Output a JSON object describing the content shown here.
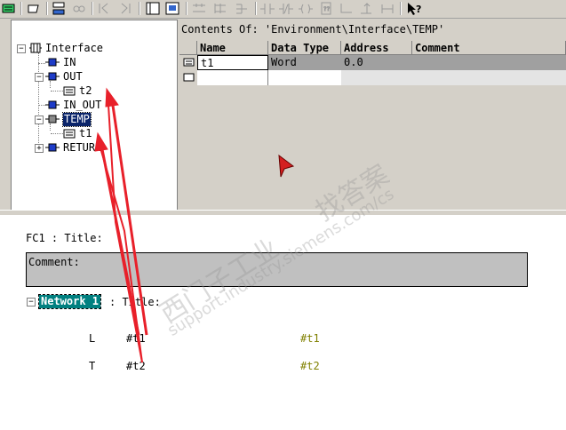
{
  "toolbar": {
    "icons": [
      "block-icon",
      "comment-icon",
      "network-icon",
      "link-icon",
      "first-network-icon",
      "last-network-icon",
      "overview-icon",
      "details-icon",
      "and-icon",
      "or-icon",
      "branch-icon",
      "branch-close-icon",
      "no-contact-icon",
      "nc-contact-icon",
      "coil-icon",
      "box-icon",
      "connection-icon",
      "arrow-icon",
      "jump-icon",
      "help-pointer-icon"
    ]
  },
  "tree": {
    "root": "Interface",
    "items": [
      {
        "label": "IN"
      },
      {
        "label": "OUT"
      },
      {
        "label": "t2"
      },
      {
        "label": "IN_OUT"
      },
      {
        "label": "TEMP"
      },
      {
        "label": "t1"
      },
      {
        "label": "RETURN"
      }
    ]
  },
  "detail": {
    "path": "Contents Of: 'Environment\\Interface\\TEMP'",
    "columns": [
      "Name",
      "Data Type",
      "Address",
      "Comment"
    ],
    "rows": [
      {
        "name": "t1",
        "type": "Word",
        "address": "0.0",
        "comment": ""
      }
    ]
  },
  "editor": {
    "block_title": "FC1 : Title:",
    "comment_label": "Comment:",
    "network_label": "Network 1",
    "network_title": ": Title:",
    "code": [
      {
        "op": "L",
        "operand": "#t1",
        "comment": "#t1"
      },
      {
        "op": "T",
        "operand": "#t2",
        "comment": "#t2"
      }
    ]
  },
  "watermark": {
    "line1": "西门子工业",
    "line2": "找答案",
    "line3": "support.industry.siemens.com/cs"
  },
  "colors": {
    "selection": "#0a246a",
    "network_bg": "#008080",
    "comment_text": "#808000",
    "annotation_arrow": "#e8202a",
    "cursor": "#d42020"
  }
}
